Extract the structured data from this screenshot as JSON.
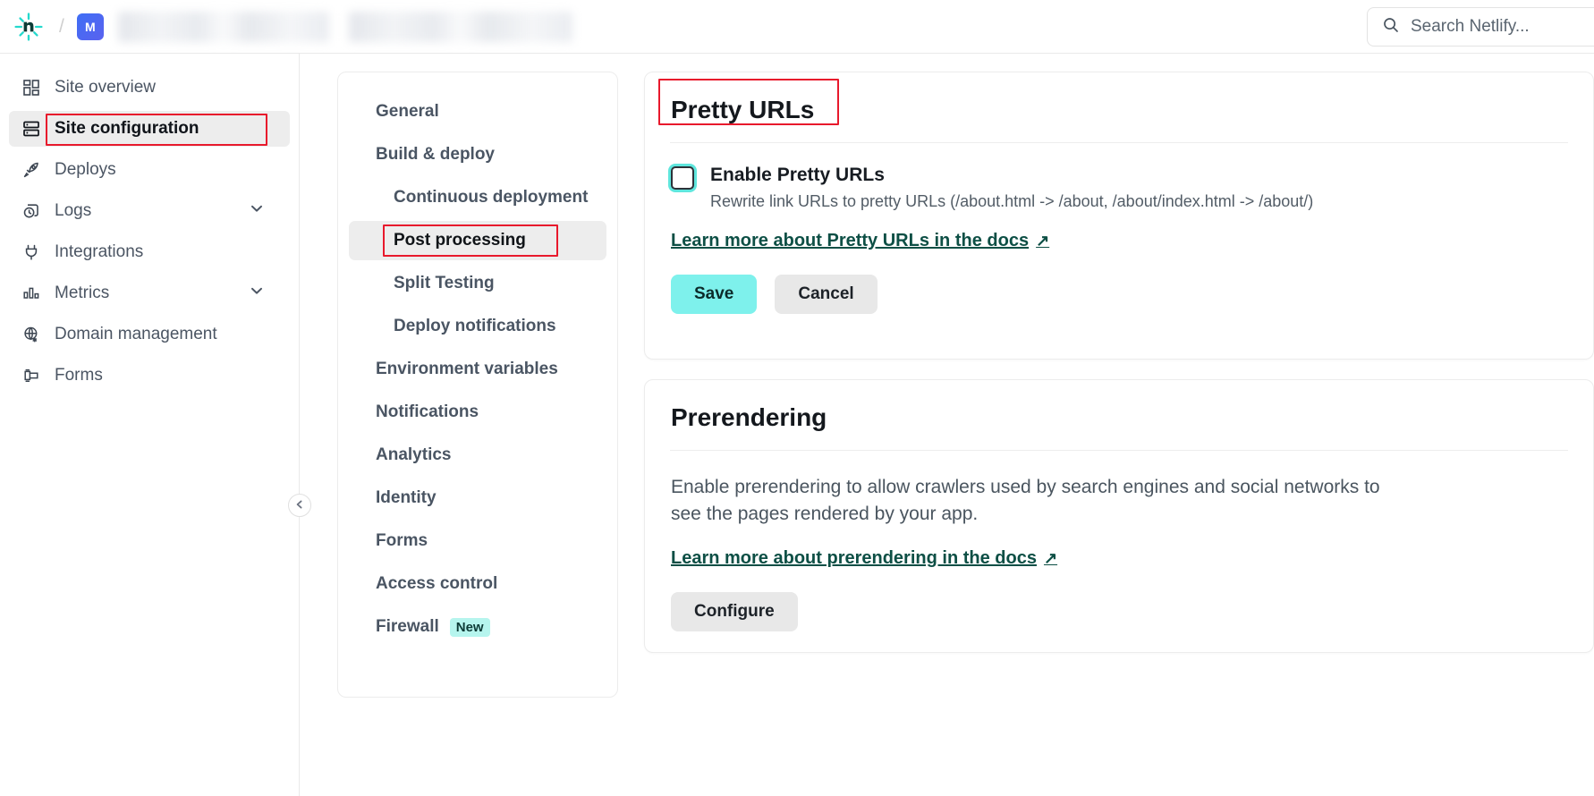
{
  "topbar": {
    "logo_icon": "netlify-logo-icon",
    "separator": "/",
    "avatar_initial": "M",
    "search": {
      "icon": "search-icon",
      "placeholder": "Search Netlify...",
      "value": ""
    }
  },
  "sidebar": {
    "items": [
      {
        "label": "Site overview",
        "icon": "grid-icon",
        "active": false,
        "expandable": false
      },
      {
        "label": "Site configuration",
        "icon": "server-icon",
        "active": true,
        "expandable": false
      },
      {
        "label": "Deploys",
        "icon": "rocket-icon",
        "active": false,
        "expandable": false
      },
      {
        "label": "Logs",
        "icon": "logs-icon",
        "active": false,
        "expandable": true
      },
      {
        "label": "Integrations",
        "icon": "plug-icon",
        "active": false,
        "expandable": false
      },
      {
        "label": "Metrics",
        "icon": "bar-chart-icon",
        "active": false,
        "expandable": true
      },
      {
        "label": "Domain management",
        "icon": "globe-icon",
        "active": false,
        "expandable": false
      },
      {
        "label": "Forms",
        "icon": "form-icon",
        "active": false,
        "expandable": false
      }
    ],
    "collapse_icon": "chevron-left-icon"
  },
  "config_nav": {
    "items": [
      {
        "label": "General",
        "sub": false,
        "active": false,
        "badge": ""
      },
      {
        "label": "Build & deploy",
        "sub": false,
        "active": false,
        "badge": ""
      },
      {
        "label": "Continuous deployment",
        "sub": true,
        "active": false,
        "badge": ""
      },
      {
        "label": "Post processing",
        "sub": true,
        "active": true,
        "badge": ""
      },
      {
        "label": "Split Testing",
        "sub": true,
        "active": false,
        "badge": ""
      },
      {
        "label": "Deploy notifications",
        "sub": true,
        "active": false,
        "badge": ""
      },
      {
        "label": "Environment variables",
        "sub": false,
        "active": false,
        "badge": ""
      },
      {
        "label": "Notifications",
        "sub": false,
        "active": false,
        "badge": ""
      },
      {
        "label": "Analytics",
        "sub": false,
        "active": false,
        "badge": ""
      },
      {
        "label": "Identity",
        "sub": false,
        "active": false,
        "badge": ""
      },
      {
        "label": "Forms",
        "sub": false,
        "active": false,
        "badge": ""
      },
      {
        "label": "Access control",
        "sub": false,
        "active": false,
        "badge": ""
      },
      {
        "label": "Firewall",
        "sub": false,
        "active": false,
        "badge": "New"
      }
    ]
  },
  "pretty_urls": {
    "title": "Pretty URLs",
    "checkbox_label": "Enable Pretty URLs",
    "checkbox_checked": false,
    "description": "Rewrite link URLs to pretty URLs (/about.html -> /about, /about/index.html -> /about/)",
    "doc_link": "Learn more about Pretty URLs in the docs",
    "doc_link_arrow": "↗",
    "save_label": "Save",
    "cancel_label": "Cancel"
  },
  "prerendering": {
    "title": "Prerendering",
    "description": "Enable prerendering to allow crawlers used by search engines and social networks to see the pages rendered by your app.",
    "doc_link": "Learn more about prerendering in the docs",
    "doc_link_arrow": "↗",
    "configure_label": "Configure"
  },
  "colors": {
    "accent_teal": "#7ef1ec",
    "link_green": "#0d4f45",
    "annotation_red": "#e8192c",
    "badge_new_bg": "#b6f5ee",
    "avatar_blue": "#3f6ef5"
  }
}
